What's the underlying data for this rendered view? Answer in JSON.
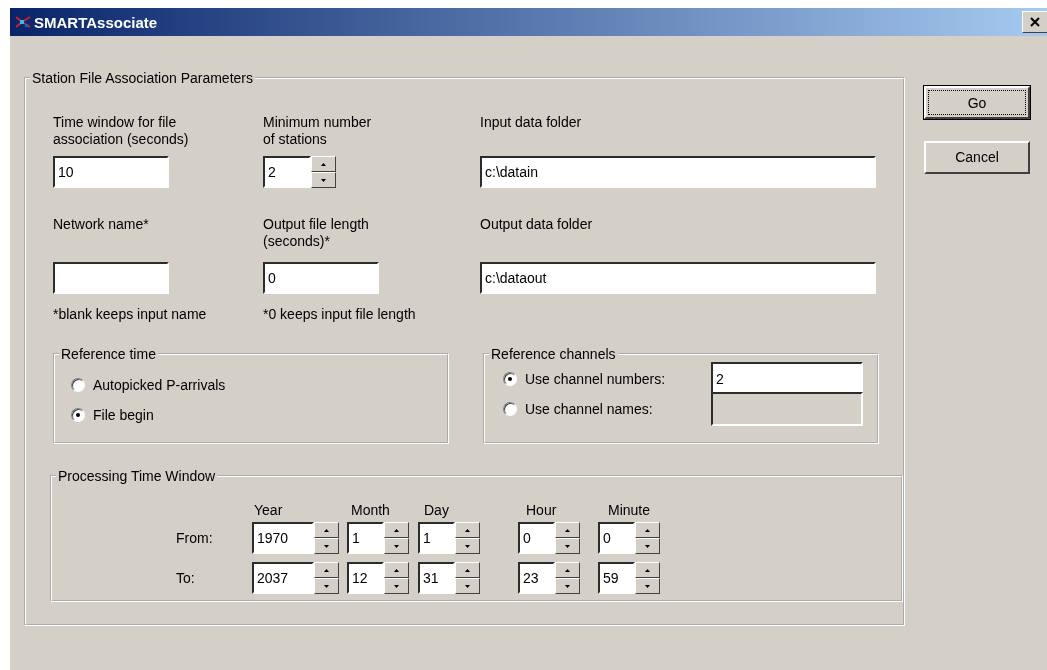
{
  "window": {
    "title": "SMARTAssociate"
  },
  "parameters": {
    "title": "Station File Association Parameters",
    "fields": [
      {
        "kind": "text",
        "label": "Time window for file association (seconds)",
        "value": "10"
      },
      {
        "kind": "spinner",
        "label": "Minimum number of stations",
        "value": "2"
      },
      {
        "kind": "text",
        "label": "Input data folder",
        "value": "c:\\datain"
      },
      {
        "kind": "text",
        "label": "Network name*",
        "note": "*blank keeps input name"
      },
      {
        "kind": "text",
        "label": "Output file length (seconds)*",
        "value": "0",
        "note": "*0 keeps input file length"
      },
      {
        "kind": "text",
        "label": "Output data folder",
        "value": "c:\\dataout"
      }
    ],
    "reference_time": {
      "title": "Reference time",
      "options": [
        {
          "label": "Autopicked P-arrivals",
          "selected": false
        },
        {
          "label": "File begin",
          "selected": true
        }
      ]
    },
    "reference_channels": {
      "title": "Reference channels",
      "options": [
        {
          "label": "Use channel numbers:",
          "selected": true,
          "value": "2",
          "disabled": false
        },
        {
          "label": "Use channel names:",
          "selected": false,
          "disabled": true
        }
      ]
    },
    "processing_time_window": {
      "title": "Processing Time Window",
      "columns": [
        "Year",
        "Month",
        "Day",
        "Hour",
        "Minute"
      ],
      "rows": [
        {
          "label": "From:",
          "values": [
            "1970",
            "1",
            "1",
            "0",
            "0"
          ]
        },
        {
          "label": "To:",
          "values": [
            "2037",
            "12",
            "31",
            "23",
            "59"
          ]
        }
      ]
    }
  },
  "buttons": [
    {
      "label": "Go",
      "default": true
    },
    {
      "label": "Cancel",
      "default": false
    }
  ]
}
